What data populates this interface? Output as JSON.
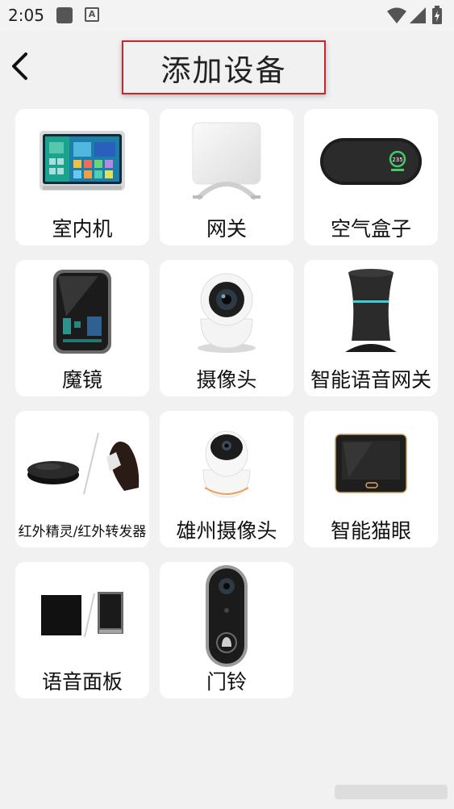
{
  "status_bar": {
    "time": "2:05",
    "notification_icon": "a-box-icon",
    "icons": [
      "wifi-icon",
      "signal-icon",
      "battery-charging-icon"
    ]
  },
  "header": {
    "back_icon": "chevron-left-icon",
    "title": "添加设备"
  },
  "devices": [
    {
      "label": "室内机",
      "icon": "indoor-panel-icon"
    },
    {
      "label": "网关",
      "icon": "gateway-icon"
    },
    {
      "label": "空气盒子",
      "icon": "air-box-icon"
    },
    {
      "label": "魔镜",
      "icon": "magic-mirror-icon"
    },
    {
      "label": "摄像头",
      "icon": "camera-icon"
    },
    {
      "label": "智能语音网关",
      "icon": "smart-speaker-gateway-icon"
    },
    {
      "label": "红外精灵/红外转发器",
      "icon": "ir-blaster-icon"
    },
    {
      "label": "雄州摄像头",
      "icon": "xiongzhou-camera-icon"
    },
    {
      "label": "智能猫眼",
      "icon": "smart-peephole-icon"
    },
    {
      "label": "语音面板",
      "icon": "voice-panel-icon"
    },
    {
      "label": "门铃",
      "icon": "doorbell-icon"
    }
  ]
}
